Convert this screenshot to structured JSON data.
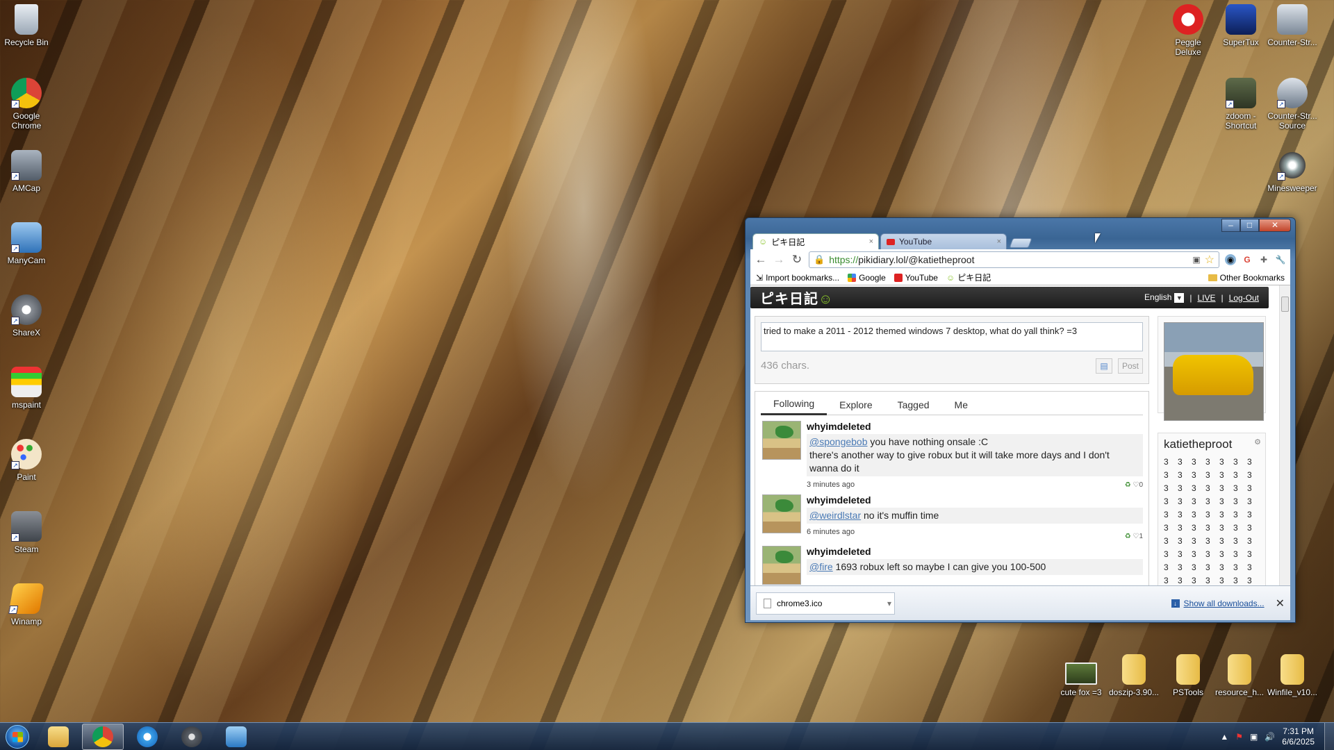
{
  "desktop": {
    "left_icons": [
      {
        "label": "Recycle Bin",
        "icon": "recycle-bin-icon"
      },
      {
        "label": "Google Chrome",
        "icon": "chrome-icon"
      },
      {
        "label": "AMCap",
        "icon": "amcap-icon"
      },
      {
        "label": "ManyCam",
        "icon": "manycam-icon"
      },
      {
        "label": "ShareX",
        "icon": "sharex-icon"
      },
      {
        "label": "mspaint",
        "icon": "mspaint-icon"
      },
      {
        "label": "Paint",
        "icon": "paint-icon"
      },
      {
        "label": "Steam",
        "icon": "steam-icon"
      },
      {
        "label": "Winamp",
        "icon": "winamp-icon"
      }
    ],
    "right_icons": [
      {
        "label": "Peggle Deluxe",
        "icon": "peggle-icon"
      },
      {
        "label": "SuperTux",
        "icon": "supertux-icon"
      },
      {
        "label": "Counter-Str...",
        "icon": "counter-strike-icon"
      },
      {
        "label": "zdoom - Shortcut",
        "icon": "zdoom-icon"
      },
      {
        "label": "Counter-Str... Source",
        "icon": "counter-strike-source-icon"
      },
      {
        "label": "Minesweeper",
        "icon": "minesweeper-icon"
      }
    ],
    "bottom_icons": [
      {
        "label": "cute fox =3",
        "icon": "image-file-icon"
      },
      {
        "label": "doszip-3.90...",
        "icon": "folder-icon"
      },
      {
        "label": "PSTools",
        "icon": "folder-icon"
      },
      {
        "label": "resource_h...",
        "icon": "folder-icon"
      },
      {
        "label": "Winfile_v10...",
        "icon": "folder-icon"
      }
    ]
  },
  "browser": {
    "tabs": [
      {
        "label": "ピキ日記",
        "active": true
      },
      {
        "label": "YouTube",
        "active": false
      }
    ],
    "url_prefix": "https://",
    "url": "pikidiary.lol/@katietheproot",
    "bookmarks": [
      "Import bookmarks...",
      "Google",
      "YouTube",
      "ピキ日記"
    ],
    "other_bookmarks": "Other Bookmarks",
    "download": {
      "file": "chrome3.ico",
      "show_all": "Show all downloads..."
    }
  },
  "site": {
    "logo": "ピキ日記",
    "language": "English",
    "live": "LIVE",
    "logout": "Log-Out",
    "composer_text": "tried to make a 2011 - 2012 themed windows 7 desktop, what do yall think? =3",
    "chars_left": "436 chars.",
    "post_button": "Post",
    "feed_tabs": [
      "Following",
      "Explore",
      "Tagged",
      "Me"
    ],
    "posts": [
      {
        "user": "whyimdeleted",
        "mention": "@spongebob",
        "text": " you have nothing onsale :C",
        "text2": "there's another way to give robux but it will take more days and I don't wanna do it",
        "time": "3 minutes ago",
        "likes": "0"
      },
      {
        "user": "whyimdeleted",
        "mention": "@weirdlstar",
        "text": " no it's muffin time",
        "text2": "",
        "time": "6 minutes ago",
        "likes": "1"
      },
      {
        "user": "whyimdeleted",
        "mention": "@fire",
        "text": " 1693 robux left so maybe I can give you 100-500",
        "text2": "",
        "time": "",
        "likes": ""
      }
    ],
    "profile_name": "katietheproot",
    "profile_bio": "3 3 3 3 3 3 3 3 3 3 3 3 3 3 3 3 3 3 3 3 3 3 3 3 3 3 3 3 3 3 3 3 3 3 3 3 3 3 3 3 3 3 3 3 3 3 3 3 3 3 3 3 3 3 3 3 3 3 3 3 3 3 3 3 3 3 3 3 3 3 3 3 3 3 3 3 3 3 3 3 3 3 3 3 3 3 3 3"
  },
  "taskbar": {
    "time": "7:31 PM",
    "date": "6/6/2025"
  },
  "colors": {
    "taskbar": "#1e3a5f",
    "site_header": "#222222",
    "link": "#4a7ab5"
  }
}
